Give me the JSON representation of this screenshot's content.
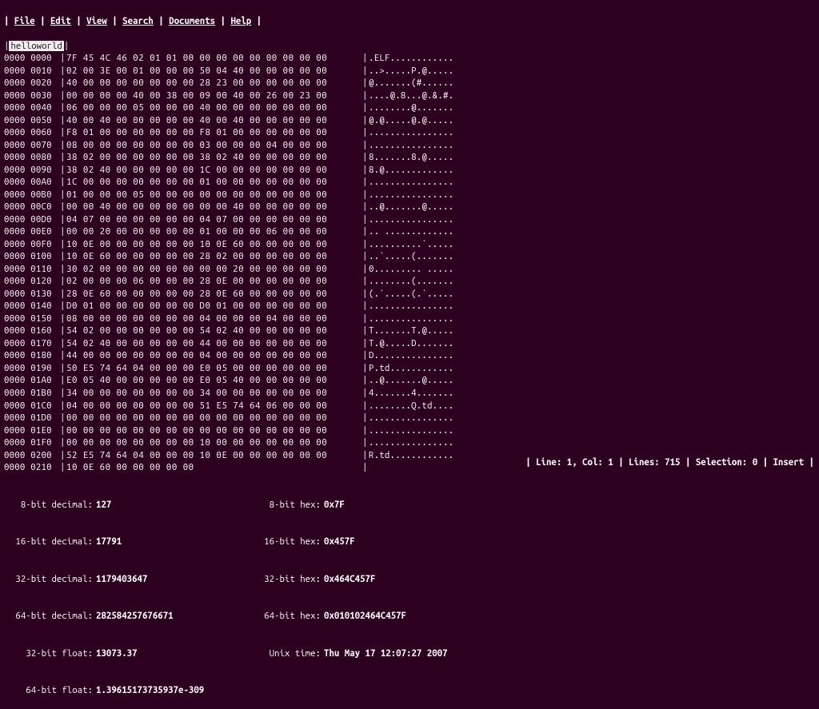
{
  "menu": {
    "items": [
      "File",
      "Edit",
      "View",
      "Search",
      "Documents",
      "Help"
    ]
  },
  "tabs": {
    "active": "helloworld"
  },
  "hex": {
    "rows": [
      {
        "a1": "0000",
        "a2": "0000",
        "h": "7F 45 4C 46 02 01 01 00 00 00 00 00 00 00 00 00",
        "s": ".ELF............"
      },
      {
        "a1": "0000",
        "a2": "0010",
        "h": "02 00 3E 00 01 00 00 00 50 04 40 00 00 00 00 00",
        "s": "..>.....P.@....."
      },
      {
        "a1": "0000",
        "a2": "0020",
        "h": "40 00 00 00 00 00 00 00 28 23 00 00 00 00 00 00",
        "s": "@.......(#......"
      },
      {
        "a1": "0000",
        "a2": "0030",
        "h": "00 00 00 00 40 00 38 00 09 00 40 00 26 00 23 00",
        "s": "....@.8...@.&.#."
      },
      {
        "a1": "0000",
        "a2": "0040",
        "h": "06 00 00 00 05 00 00 00 40 00 00 00 00 00 00 00",
        "s": "........@......."
      },
      {
        "a1": "0000",
        "a2": "0050",
        "h": "40 00 40 00 00 00 00 00 40 00 40 00 00 00 00 00",
        "s": "@.@.....@.@....."
      },
      {
        "a1": "0000",
        "a2": "0060",
        "h": "F8 01 00 00 00 00 00 00 F8 01 00 00 00 00 00 00",
        "s": "................"
      },
      {
        "a1": "0000",
        "a2": "0070",
        "h": "08 00 00 00 00 00 00 00 03 00 00 00 04 00 00 00",
        "s": "................"
      },
      {
        "a1": "0000",
        "a2": "0080",
        "h": "38 02 00 00 00 00 00 00 38 02 40 00 00 00 00 00",
        "s": "8.......8.@....."
      },
      {
        "a1": "0000",
        "a2": "0090",
        "h": "38 02 40 00 00 00 00 00 1C 00 00 00 00 00 00 00",
        "s": "8.@............."
      },
      {
        "a1": "0000",
        "a2": "00A0",
        "h": "1C 00 00 00 00 00 00 00 01 00 00 00 00 00 00 00",
        "s": "................"
      },
      {
        "a1": "0000",
        "a2": "00B0",
        "h": "01 00 00 00 05 00 00 00 00 00 00 00 00 00 00 00",
        "s": "................"
      },
      {
        "a1": "0000",
        "a2": "00C0",
        "h": "00 00 40 00 00 00 00 00 00 00 40 00 00 00 00 00",
        "s": "..@.......@....."
      },
      {
        "a1": "0000",
        "a2": "00D0",
        "h": "04 07 00 00 00 00 00 00 04 07 00 00 00 00 00 00",
        "s": "................"
      },
      {
        "a1": "0000",
        "a2": "00E0",
        "h": "00 00 20 00 00 00 00 00 01 00 00 00 06 00 00 00",
        "s": ".. ............."
      },
      {
        "a1": "0000",
        "a2": "00F0",
        "h": "10 0E 00 00 00 00 00 00 10 0E 60 00 00 00 00 00",
        "s": "..........`....."
      },
      {
        "a1": "0000",
        "a2": "0100",
        "h": "10 0E 60 00 00 00 00 00 28 02 00 00 00 00 00 00",
        "s": "..`.....(......."
      },
      {
        "a1": "0000",
        "a2": "0110",
        "h": "30 02 00 00 00 00 00 00 00 00 20 00 00 00 00 00",
        "s": "0......... ....."
      },
      {
        "a1": "0000",
        "a2": "0120",
        "h": "02 00 00 00 06 00 00 00 28 0E 00 00 00 00 00 00",
        "s": "........(......."
      },
      {
        "a1": "0000",
        "a2": "0130",
        "h": "28 0E 60 00 00 00 00 00 28 0E 60 00 00 00 00 00",
        "s": "(.`.....(.`....."
      },
      {
        "a1": "0000",
        "a2": "0140",
        "h": "D0 01 00 00 00 00 00 00 D0 01 00 00 00 00 00 00",
        "s": "................"
      },
      {
        "a1": "0000",
        "a2": "0150",
        "h": "08 00 00 00 00 00 00 00 04 00 00 00 04 00 00 00",
        "s": "................"
      },
      {
        "a1": "0000",
        "a2": "0160",
        "h": "54 02 00 00 00 00 00 00 54 02 40 00 00 00 00 00",
        "s": "T.......T.@....."
      },
      {
        "a1": "0000",
        "a2": "0170",
        "h": "54 02 40 00 00 00 00 00 44 00 00 00 00 00 00 00",
        "s": "T.@.....D......."
      },
      {
        "a1": "0000",
        "a2": "0180",
        "h": "44 00 00 00 00 00 00 00 04 00 00 00 00 00 00 00",
        "s": "D..............."
      },
      {
        "a1": "0000",
        "a2": "0190",
        "h": "50 E5 74 64 04 00 00 00 E0 05 00 00 00 00 00 00",
        "s": "P.td............"
      },
      {
        "a1": "0000",
        "a2": "01A0",
        "h": "E0 05 40 00 00 00 00 00 E0 05 40 00 00 00 00 00",
        "s": "..@.......@....."
      },
      {
        "a1": "0000",
        "a2": "01B0",
        "h": "34 00 00 00 00 00 00 00 34 00 00 00 00 00 00 00",
        "s": "4.......4......."
      },
      {
        "a1": "0000",
        "a2": "01C0",
        "h": "04 00 00 00 00 00 00 00 51 E5 74 64 06 00 00 00",
        "s": "........Q.td...."
      },
      {
        "a1": "0000",
        "a2": "01D0",
        "h": "00 00 00 00 00 00 00 00 00 00 00 00 00 00 00 00",
        "s": "................"
      },
      {
        "a1": "0000",
        "a2": "01E0",
        "h": "00 00 00 00 00 00 00 00 00 00 00 00 00 00 00 00",
        "s": "................"
      },
      {
        "a1": "0000",
        "a2": "01F0",
        "h": "00 00 00 00 00 00 00 00 10 00 00 00 00 00 00 00",
        "s": "................"
      },
      {
        "a1": "0000",
        "a2": "0200",
        "h": "52 E5 74 64 04 00 00 00 10 0E 00 00 00 00 00 00",
        "s": "R.td............"
      },
      {
        "a1": "0000",
        "a2": "0210",
        "h": "10 0E 60 00 00 00 00 00",
        "s": ""
      }
    ]
  },
  "info": {
    "dec8_lbl": "8-bit decimal:",
    "dec8": "127",
    "dec16_lbl": "16-bit decimal:",
    "dec16": "17791",
    "dec32_lbl": "32-bit decimal:",
    "dec32": "1179403647",
    "dec64_lbl": "64-bit decimal:",
    "dec64": "282584257676671",
    "f32_lbl": "32-bit float:",
    "f32": "13073.37",
    "f64_lbl": "64-bit float:",
    "f64": "1.39615173735937e-309",
    "hex8_lbl": "8-bit hex:",
    "hex8": "0x7F",
    "hex16_lbl": "16-bit hex:",
    "hex16": "0x457F",
    "hex32_lbl": "32-bit hex:",
    "hex32": "0x464C457F",
    "hex64_lbl": "64-bit hex:",
    "hex64": "0x010102464C457F",
    "unix_lbl": "Unix time:",
    "unix": "Thu May 17 12:07:27 2007"
  },
  "status": {
    "line_lbl": "Line:",
    "line": "1",
    "col_lbl": "Col:",
    "col": "1",
    "lines_lbl": "Lines:",
    "lines": "715",
    "sel_lbl": "Selection:",
    "sel": "0",
    "mode": "Insert"
  }
}
